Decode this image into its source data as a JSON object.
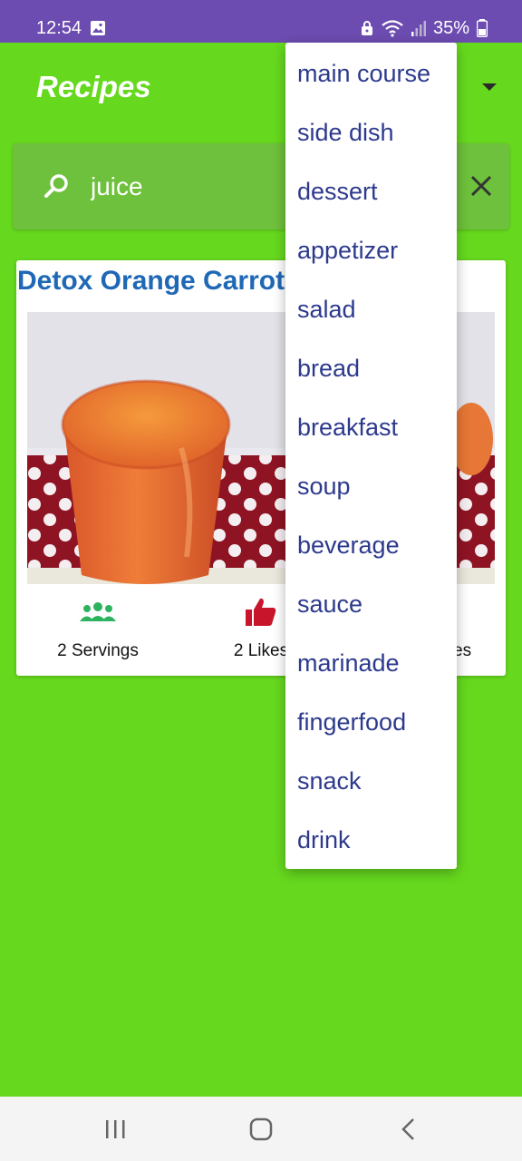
{
  "status_bar": {
    "time": "12:54",
    "battery": "35%",
    "icons": [
      "photo-icon",
      "lock-icon",
      "wifi-icon",
      "signal-icon",
      "battery-icon"
    ]
  },
  "app_bar": {
    "title": "Recipes",
    "dropdown_icon": "arrow-drop-down-icon"
  },
  "search": {
    "value": "juice",
    "icon": "search-icon",
    "clear_icon": "close-icon"
  },
  "recipe_card": {
    "title": "Detox Orange Carrot",
    "servings_label": "2 Servings",
    "likes_label": "2 Likes",
    "time_label_fragment": "es",
    "servings_icon": "people-icon",
    "likes_icon": "thumb-up-icon"
  },
  "dropdown_menu": {
    "items": [
      {
        "label": "main course"
      },
      {
        "label": "side dish"
      },
      {
        "label": "dessert"
      },
      {
        "label": "appetizer"
      },
      {
        "label": "salad"
      },
      {
        "label": "bread"
      },
      {
        "label": "breakfast"
      },
      {
        "label": "soup"
      },
      {
        "label": "beverage"
      },
      {
        "label": "sauce"
      },
      {
        "label": "marinade"
      },
      {
        "label": "fingerfood"
      },
      {
        "label": "snack"
      },
      {
        "label": "drink"
      }
    ]
  },
  "nav_bar": {
    "icons": [
      "recent-apps-icon",
      "home-icon",
      "back-icon"
    ]
  },
  "colors": {
    "background": "#66d91e",
    "status_bar": "#6c4cb0",
    "title_blue": "#1f68b5",
    "menu_text": "#2d3a8c",
    "servings_green": "#2db35d",
    "likes_red": "#c8152b"
  }
}
